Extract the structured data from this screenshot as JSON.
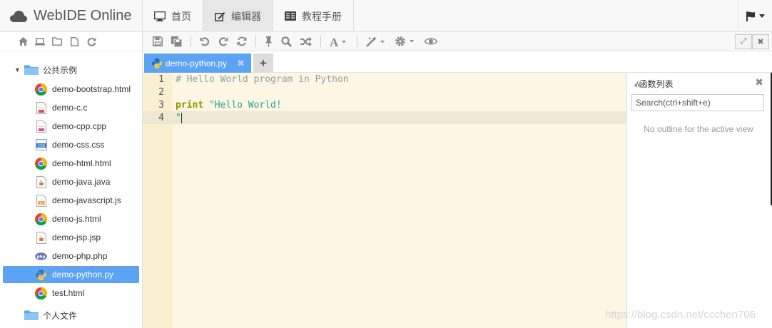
{
  "app": {
    "title": "WebIDE Online"
  },
  "nav": {
    "tabs": [
      {
        "label": "首页",
        "icon": "monitor-icon"
      },
      {
        "label": "编辑器",
        "icon": "edit-icon"
      },
      {
        "label": "教程手册",
        "icon": "book-icon"
      }
    ],
    "active_tab": 1
  },
  "sidebar": {
    "toolbar_icons": [
      "home-icon",
      "laptop-icon",
      "folder-icon",
      "file-icon",
      "refresh-icon"
    ],
    "folder": {
      "label": "公共示例",
      "expanded": true
    },
    "files": [
      {
        "name": "demo-bootstrap.html",
        "icon": "chrome-icon"
      },
      {
        "name": "demo-c.c",
        "icon": "c-file-icon"
      },
      {
        "name": "demo-cpp.cpp",
        "icon": "cpp-file-icon"
      },
      {
        "name": "demo-css.css",
        "icon": "css-file-icon"
      },
      {
        "name": "demo-html.html",
        "icon": "chrome-icon"
      },
      {
        "name": "demo-java.java",
        "icon": "java-file-icon"
      },
      {
        "name": "demo-javascript.js",
        "icon": "js-file-icon"
      },
      {
        "name": "demo-js.html",
        "icon": "chrome-icon"
      },
      {
        "name": "demo-jsp.jsp",
        "icon": "java-file-icon"
      },
      {
        "name": "demo-php.php",
        "icon": "php-icon"
      },
      {
        "name": "demo-python.py",
        "icon": "python-icon"
      },
      {
        "name": "test.html",
        "icon": "chrome-icon"
      }
    ],
    "selected_file": "demo-python.py",
    "folder2": {
      "label": "个人文件"
    }
  },
  "editor": {
    "toolbar_icons": [
      "save-icon",
      "save-all-icon",
      "undo-icon",
      "redo-icon",
      "refresh-icon",
      "pin-icon",
      "search-icon",
      "shuffle-icon",
      "font-icon",
      "magic-wand-icon",
      "settings-icon",
      "eye-icon"
    ],
    "window_buttons": [
      "expand-icon",
      "close-icon"
    ],
    "open_tab": {
      "name": "demo-python.py",
      "close": "✖"
    },
    "add_tab": "+",
    "line_numbers": [
      "1",
      "2",
      "3",
      "4"
    ],
    "code": {
      "line1_comment": "# Hello World program in Python",
      "line3_keyword": "print",
      "line3_string": " \"Hello World!",
      "line4_string": "\""
    }
  },
  "outline": {
    "title": "函数列表",
    "title_icon": "code-icon",
    "search_placeholder": "Search(ctrl+shift+e)",
    "empty_message": "No outline for the active view",
    "close": "✖"
  },
  "watermark": "https://blog.csdn.net/ccchen706",
  "colors": {
    "accent": "#5ca4f3",
    "editor_bg": "#fdf6e3",
    "gutter_bg": "#f9efd1",
    "keyword": "#859900",
    "string": "#2aa198",
    "comment": "#93a1a1"
  }
}
